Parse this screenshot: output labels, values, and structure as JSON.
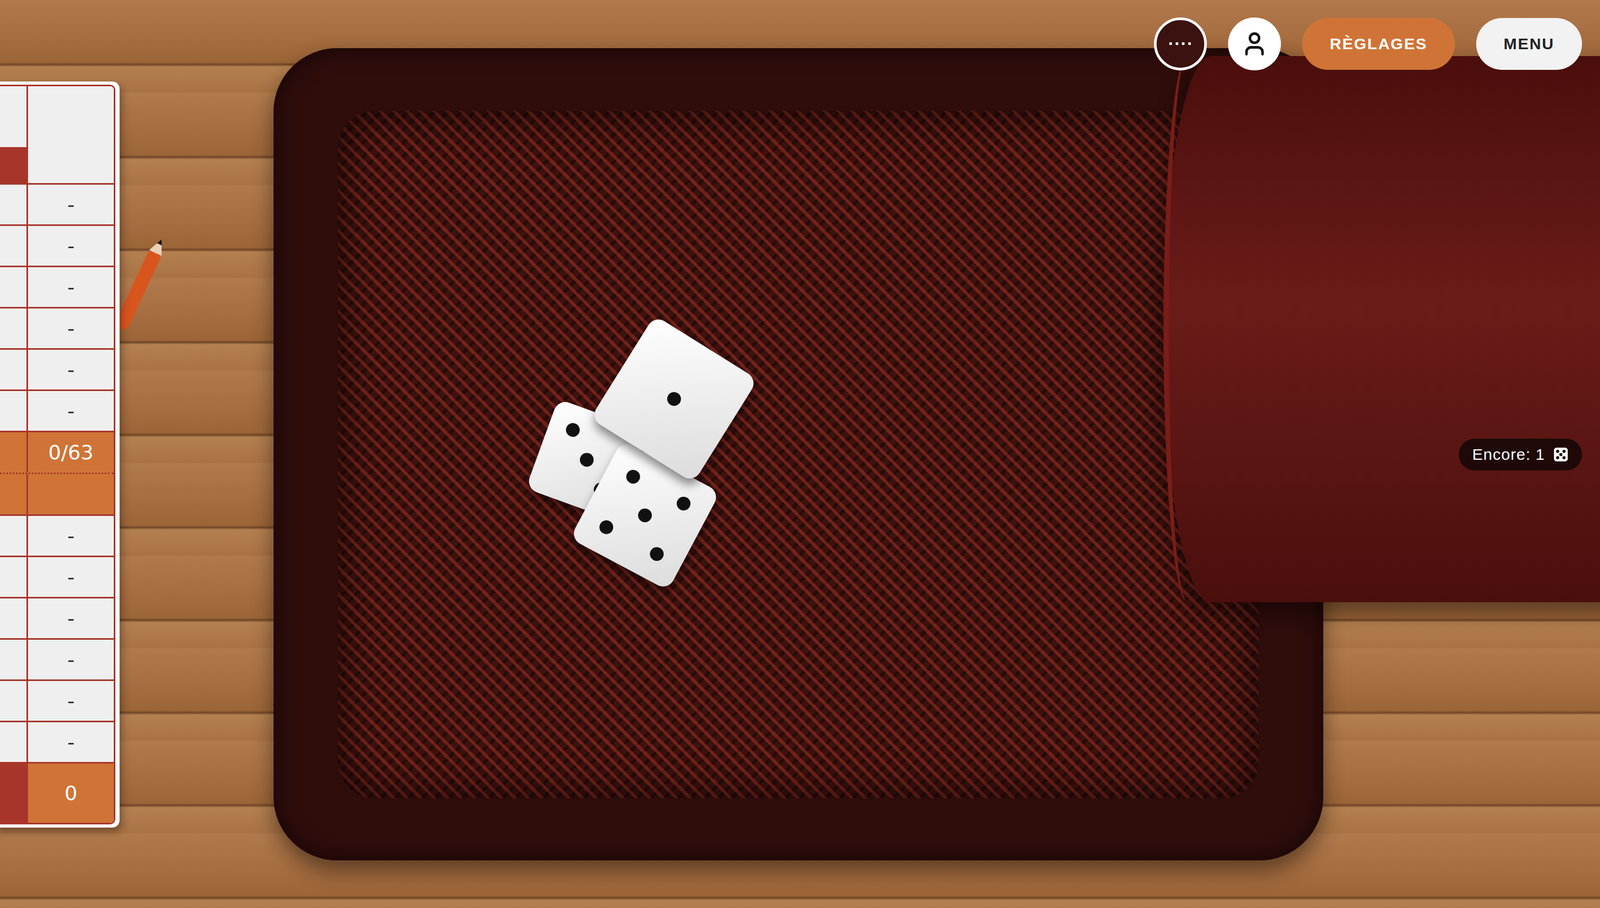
{
  "toolbar": {
    "dots": "····",
    "settings": "RÈGLAGES",
    "menu": "MENU"
  },
  "remaining": {
    "label": "Encore: 1"
  },
  "scorecard": {
    "upper": [
      "-",
      "-",
      "-",
      "-",
      "-",
      "-"
    ],
    "bonus": "0/63",
    "lower": [
      "-",
      "-",
      "-",
      "-",
      "-",
      "-"
    ],
    "total": "0"
  },
  "dice": [
    {
      "value": 3
    },
    {
      "value": 5
    },
    {
      "value": 1
    }
  ]
}
